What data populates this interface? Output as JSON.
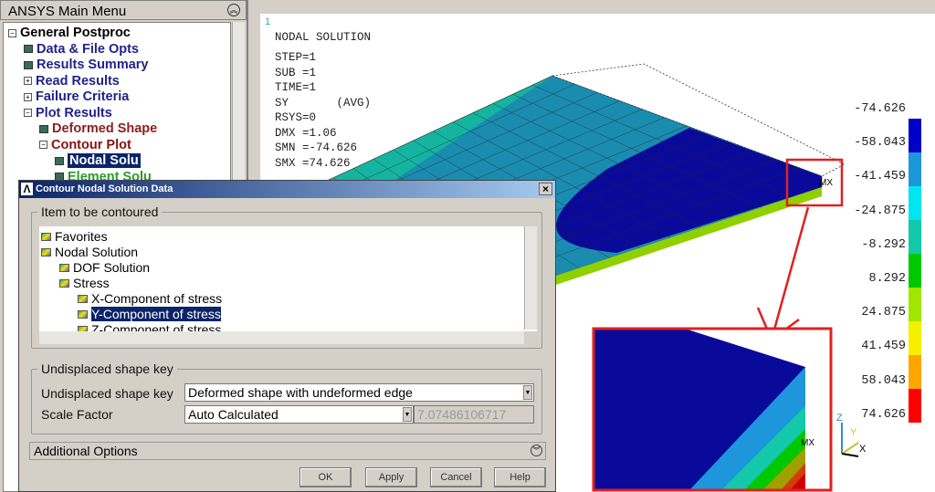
{
  "main_menu": {
    "title": "ANSYS Main Menu",
    "items": [
      {
        "label": "General Postproc",
        "level": 0,
        "icon": "collapse-box",
        "color": "#000000"
      },
      {
        "label": "Data & File Opts",
        "level": 1,
        "icon": "doc",
        "color": "#22228a"
      },
      {
        "label": "Results Summary",
        "level": 1,
        "icon": "doc",
        "color": "#22228a"
      },
      {
        "label": "Read Results",
        "level": 1,
        "icon": "expand-box",
        "color": "#22228a"
      },
      {
        "label": "Failure Criteria",
        "level": 1,
        "icon": "expand-box",
        "color": "#22228a"
      },
      {
        "label": "Plot Results",
        "level": 1,
        "icon": "collapse-box",
        "color": "#22228a"
      },
      {
        "label": "Deformed Shape",
        "level": 2,
        "icon": "doc",
        "color": "#8b2020"
      },
      {
        "label": "Contour Plot",
        "level": 2,
        "icon": "collapse-box",
        "color": "#8b1010"
      },
      {
        "label": "Nodal Solu",
        "level": 3,
        "icon": "doc",
        "color": "#ffffff",
        "selected": true
      },
      {
        "label": "Element Solu",
        "level": 3,
        "icon": "doc",
        "color": "#2a9a2a"
      }
    ]
  },
  "graphics": {
    "window_number": "1",
    "title": "NODAL SOLUTION",
    "lines": [
      "STEP=1",
      "SUB =1",
      "TIME=1",
      "SY       (AVG)",
      "RSYS=0",
      "DMX =1.06",
      "SMN =-74.626",
      "SMX =74.626"
    ],
    "mx_label": "MX",
    "axes": {
      "z": "Z",
      "y": "Y",
      "x": "X"
    }
  },
  "legend": {
    "labels": [
      "-74.626",
      "-58.043",
      "-41.459",
      "-24.875",
      "-8.292",
      "8.292",
      "24.875",
      "41.459",
      "58.043",
      "74.626"
    ],
    "colors": [
      "#0000c8",
      "#1e96dc",
      "#00e6f0",
      "#14c8aa",
      "#00c800",
      "#a0e600",
      "#f5f000",
      "#ffa500",
      "#ff0000"
    ]
  },
  "dialog": {
    "title": "Contour Nodal Solution Data",
    "close": "×",
    "item_group": "Item to be contoured",
    "items": [
      {
        "label": "Favorites",
        "level": 0
      },
      {
        "label": "Nodal Solution",
        "level": 0
      },
      {
        "label": "DOF Solution",
        "level": 1
      },
      {
        "label": "Stress",
        "level": 1
      },
      {
        "label": "X-Component of stress",
        "level": 2
      },
      {
        "label": "Y-Component of stress",
        "level": 2,
        "selected": true
      },
      {
        "label": "Z-Component of stress",
        "level": 2
      }
    ],
    "shape_group": "Undisplaced shape key",
    "shape_key_label": "Undisplaced shape key",
    "shape_key_value": "Deformed shape with undeformed edge",
    "scale_label": "Scale Factor",
    "scale_value": "Auto Calculated",
    "scale_number": "7.07486106717",
    "additional": "Additional Options",
    "buttons": {
      "ok": "OK",
      "apply": "Apply",
      "cancel": "Cancel",
      "help": "Help"
    }
  }
}
